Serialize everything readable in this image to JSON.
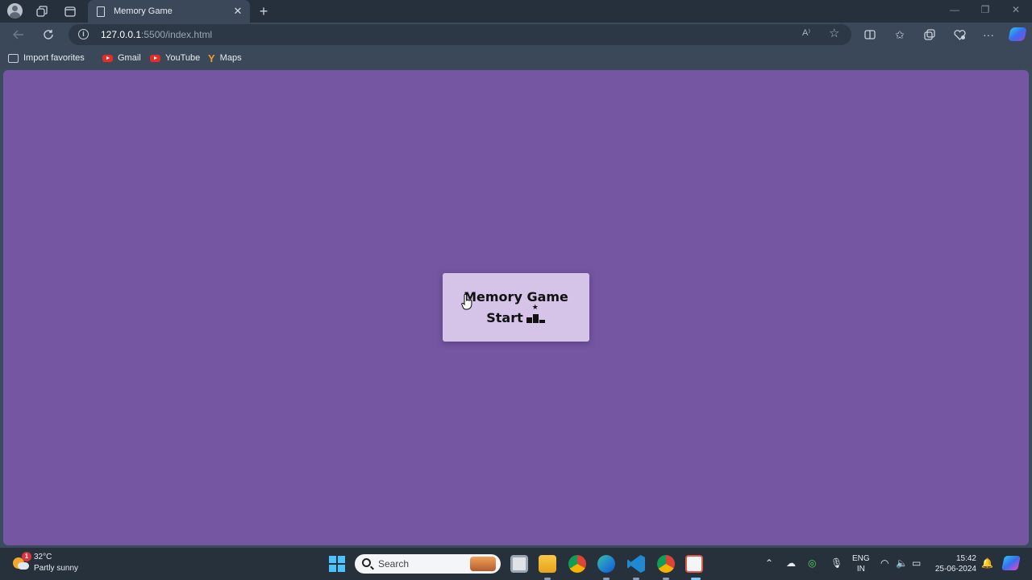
{
  "browser": {
    "tab": {
      "title": "Memory Game",
      "close_glyph": "✕"
    },
    "new_tab_glyph": "+",
    "address": {
      "host": "127.0.0.1",
      "path": ":5500/index.html"
    },
    "favorites": [
      {
        "label": "Import favorites",
        "icon": "import-icon"
      },
      {
        "label": "Gmail",
        "icon": "youtube-logo-icon"
      },
      {
        "label": "YouTube",
        "icon": "youtube-logo-icon"
      },
      {
        "label": "Maps",
        "icon": "maps-icon"
      }
    ],
    "read_aloud_glyph": "A⁾"
  },
  "page": {
    "background": "#7456a2",
    "card": {
      "background": "#d5c3e8",
      "title": "Memory Game",
      "start_label": "Start"
    }
  },
  "taskbar": {
    "weather": {
      "badge": "1",
      "temperature": "32°C",
      "condition": "Partly sunny"
    },
    "search": {
      "placeholder": "Search"
    },
    "language": {
      "line1": "ENG",
      "line2": "IN"
    },
    "clock": {
      "time": "15:42",
      "date": "25-06-2024"
    }
  }
}
